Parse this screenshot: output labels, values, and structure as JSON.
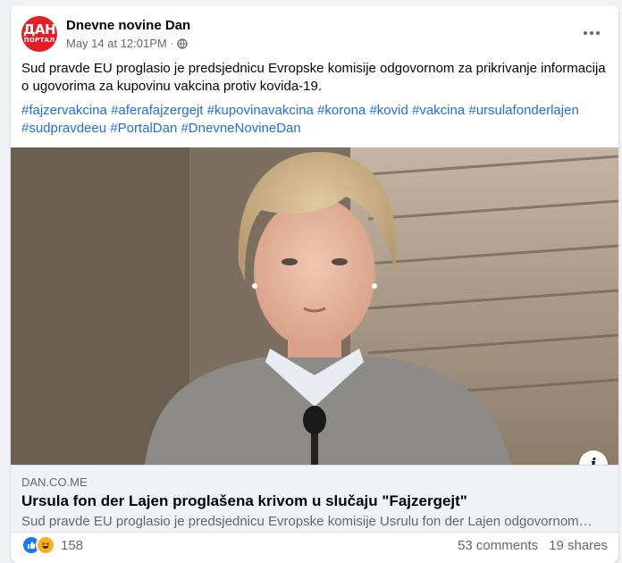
{
  "post": {
    "page_name": "Dnevne novine Dan",
    "avatar_text_top": "ДАН",
    "avatar_text_bottom": "ПОРТАЛ",
    "timestamp": "May 14 at 12:01PM",
    "separator": "·",
    "audience_icon": "globe-icon",
    "more_icon": "more-options-icon",
    "text": "Sud pravde EU proglasio je predsjednicu Evropske komisije  odgovornom za prikrivanje informacija o ugovorima za kupovinu vakcina protiv kovida-19.",
    "hashtags": [
      "#fajzervakcina",
      "#aferafajzergejt",
      "#kupovinavakcina",
      "#korona",
      "#kovid",
      "#vakcina",
      "#ursulafonderlajen",
      "#sudpravdeeu",
      "#PortalDan",
      "#DnevneNovineDan"
    ]
  },
  "link": {
    "domain": "DAN.CO.ME",
    "title": "Ursula fon der Lajen proglašena krivom u slučaju \"Fajzergejt\"",
    "description": "Sud pravde EU proglasio je predsjednicu Evropske komisije Usrulu fon der Lajen odgovornom ...",
    "info_label": "i"
  },
  "footer": {
    "reaction_icons": [
      "like-icon",
      "haha-icon"
    ],
    "reaction_count": "158",
    "comments": "53 comments",
    "shares": "19 shares"
  },
  "colors": {
    "brand_red": "#e41e26",
    "link_blue": "#216fdb",
    "like_blue": "#1877f2",
    "haha_yellow": "#f7b125"
  }
}
